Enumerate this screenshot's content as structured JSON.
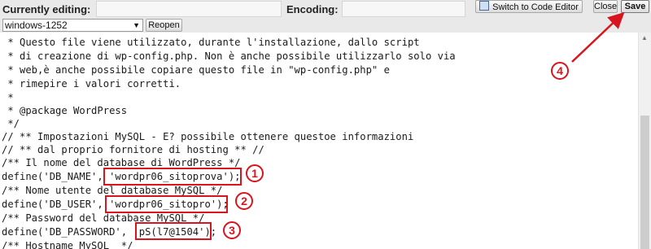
{
  "toolbar": {
    "currently_editing_label": "Currently editing:",
    "encoding_label": "Encoding:",
    "encoding_value": "windows-1252",
    "reopen_label": "Reopen",
    "switch_label": "Switch to Code Editor",
    "close_label": "Close",
    "save_label": "Save"
  },
  "code_lines": [
    " * Questo file viene utilizzato, durante l'installazione, dallo script",
    " * di creazione di wp-config.php. Non è anche possibile utilizzarlo solo via",
    " * web,è anche possibile copiare questo file in \"wp-config.php\" e",
    " * rimepire i valori corretti.",
    " *",
    " * @package WordPress",
    " */",
    "// ** Impostazioni MySQL - E? possibile ottenere questoe informazioni",
    "// ** dal proprio fornitore di hosting ** //",
    "/** Il nome del database di WordPress */",
    "define('DB_NAME', 'wordpr06_sitoprova');",
    "/** Nome utente del database MySQL */",
    "define('DB_USER', 'wordpr06_sitopro');",
    "/** Password del database MySQL */",
    "define('DB_PASSWORD', 'pS(l7@1504');",
    "/** Hostname MySQL  */"
  ],
  "annotations": {
    "marker_1": "1",
    "marker_2": "2",
    "marker_3": "3",
    "marker_4": "4"
  },
  "colors": {
    "annotation_red": "#d8141e",
    "toolbar_bg": "#e9e9e9"
  }
}
